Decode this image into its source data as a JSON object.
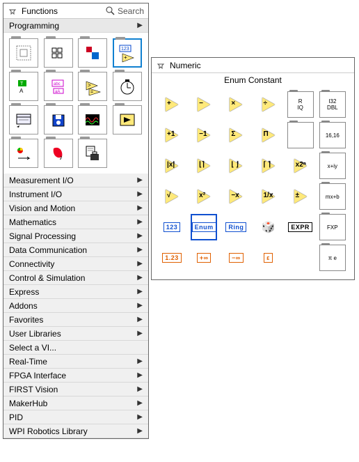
{
  "mainPalette": {
    "title": "Functions",
    "searchLabel": "Search",
    "openCategory": "Programming",
    "categories": [
      "Measurement I/O",
      "Instrument I/O",
      "Vision and Motion",
      "Mathematics",
      "Signal Processing",
      "Data Communication",
      "Connectivity",
      "Control & Simulation",
      "Express",
      "Addons",
      "Favorites",
      "User Libraries",
      "Select a VI...",
      "Real-Time",
      "FPGA Interface",
      "FIRST Vision",
      "MakerHub",
      "PID",
      "WPI Robotics Library"
    ],
    "categoriesWithArrow": [
      "Measurement I/O",
      "Instrument I/O",
      "Vision and Motion",
      "Mathematics",
      "Signal Processing",
      "Data Communication",
      "Connectivity",
      "Control & Simulation",
      "Express",
      "Addons",
      "Favorites",
      "User Libraries",
      "Real-Time",
      "FPGA Interface",
      "FIRST Vision",
      "MakerHub",
      "PID",
      "WPI Robotics Library"
    ],
    "programmingIcons": [
      "structures",
      "array",
      "cluster",
      "numeric",
      "boolean",
      "string",
      "comparison",
      "timing",
      "dialog",
      "file-io",
      "waveform",
      "app-control",
      "sync",
      "graphics",
      "report",
      "blank"
    ]
  },
  "subPalette": {
    "title": "Numeric",
    "highlightedItem": "Enum Constant",
    "cells": [
      {
        "id": "add",
        "sym": "+",
        "type": "tri"
      },
      {
        "id": "sub",
        "sym": "−",
        "type": "tri"
      },
      {
        "id": "mul",
        "sym": "×",
        "type": "tri"
      },
      {
        "id": "div",
        "sym": "÷",
        "type": "tri"
      },
      {
        "id": "quot-rem",
        "sym": "R\nIQ",
        "type": "folder"
      },
      {
        "id": "conversion",
        "sym": "I32\nDBL",
        "type": "folder"
      },
      {
        "id": "inc",
        "sym": "+1",
        "type": "tri"
      },
      {
        "id": "dec",
        "sym": "−1",
        "type": "tri"
      },
      {
        "id": "sum",
        "sym": "Σ",
        "type": "tri"
      },
      {
        "id": "prod",
        "sym": "Π",
        "type": "tri"
      },
      {
        "id": "compound",
        "sym": "",
        "type": "folder-icon"
      },
      {
        "id": "data-manip",
        "sym": "16,16",
        "type": "folder"
      },
      {
        "id": "abs",
        "sym": "|x|",
        "type": "tri"
      },
      {
        "id": "round",
        "sym": "⌊⌉",
        "type": "tri"
      },
      {
        "id": "floor",
        "sym": "⌊ ⌋",
        "type": "tri"
      },
      {
        "id": "ceil",
        "sym": "⌈ ⌉",
        "type": "tri"
      },
      {
        "id": "scale2",
        "sym": "x2ⁿ",
        "type": "tri"
      },
      {
        "id": "complex",
        "sym": "x+iy",
        "type": "folder"
      },
      {
        "id": "sqrt",
        "sym": "√",
        "type": "tri"
      },
      {
        "id": "sq",
        "sym": "x²",
        "type": "tri"
      },
      {
        "id": "neg",
        "sym": "−x",
        "type": "tri"
      },
      {
        "id": "recip",
        "sym": "1/x",
        "type": "tri"
      },
      {
        "id": "sign",
        "sym": "±",
        "type": "tri"
      },
      {
        "id": "scaling",
        "sym": "mx+b",
        "type": "folder"
      },
      {
        "id": "num-const",
        "sym": "123",
        "type": "box-blue"
      },
      {
        "id": "enum-const",
        "sym": "Enum",
        "type": "box-blue-selected"
      },
      {
        "id": "ring-const",
        "sym": "Ring",
        "type": "box-blue"
      },
      {
        "id": "random",
        "sym": "🎲",
        "type": "plain"
      },
      {
        "id": "expr-node",
        "sym": "EXPR",
        "type": "box-black"
      },
      {
        "id": "fixed-point",
        "sym": "FXP",
        "type": "folder"
      },
      {
        "id": "dbl-const",
        "sym": "1.23",
        "type": "box-orange"
      },
      {
        "id": "pos-inf",
        "sym": "+∞",
        "type": "box-orange"
      },
      {
        "id": "neg-inf",
        "sym": "−∞",
        "type": "box-orange"
      },
      {
        "id": "eps",
        "sym": "ε",
        "type": "box-orange"
      },
      {
        "id": "blank",
        "sym": "",
        "type": "empty"
      },
      {
        "id": "math-const",
        "sym": "π e",
        "type": "folder"
      }
    ]
  }
}
